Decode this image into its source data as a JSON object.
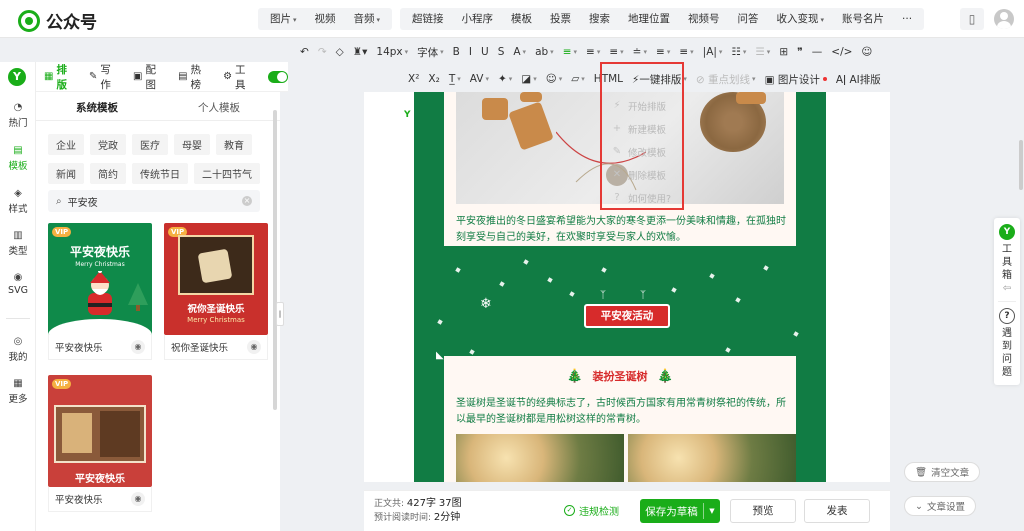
{
  "app": {
    "title": "公众号"
  },
  "topnav": {
    "media": [
      {
        "label": "图片",
        "caret": true
      },
      {
        "label": "视频",
        "caret": false
      },
      {
        "label": "音频",
        "caret": true
      }
    ],
    "insert": [
      {
        "label": "超链接",
        "caret": false
      },
      {
        "label": "小程序",
        "caret": false
      },
      {
        "label": "模板",
        "caret": false
      },
      {
        "label": "投票",
        "caret": false
      },
      {
        "label": "搜索",
        "caret": false
      },
      {
        "label": "地理位置",
        "caret": false
      },
      {
        "label": "视频号",
        "caret": false
      },
      {
        "label": "问答",
        "caret": false
      },
      {
        "label": "收入变现",
        "caret": true
      },
      {
        "label": "账号名片",
        "caret": false
      },
      {
        "label": "···",
        "caret": false
      }
    ]
  },
  "rail": {
    "brand": "Y",
    "items": [
      {
        "label": "热门",
        "icon": "◔"
      },
      {
        "label": "模板",
        "icon": "▤"
      },
      {
        "label": "样式",
        "icon": "◈"
      },
      {
        "label": "类型",
        "icon": "▥"
      },
      {
        "label": "SVG",
        "icon": "◉"
      },
      {
        "label": "我的",
        "icon": "◎"
      },
      {
        "label": "更多",
        "icon": "▦"
      }
    ]
  },
  "panel": {
    "tabs": [
      {
        "label": "排版",
        "icon": "▦"
      },
      {
        "label": "写作",
        "icon": "✎"
      },
      {
        "label": "配图",
        "icon": "▣"
      },
      {
        "label": "热榜",
        "icon": "▤"
      },
      {
        "label": "工具",
        "icon": "⚙"
      }
    ],
    "subtabs": [
      "系统模板",
      "个人模板"
    ],
    "categories": [
      "企业",
      "党政",
      "医疗",
      "母婴",
      "教育",
      "新闻",
      "简约",
      "传统节日",
      "二十四节气"
    ],
    "search": {
      "value": "平安夜",
      "icon": "⌕",
      "clear": "×"
    },
    "cards": [
      {
        "name": "平安夜快乐",
        "thumb_title": "平安夜快乐",
        "thumb_sub": "Merry Christmas",
        "vip": "VIP"
      },
      {
        "name": "祝你圣诞快乐",
        "thumb_title": "祝你圣诞快乐",
        "thumb_sub": "Merry Christmas",
        "vip": "VIP"
      },
      {
        "name": "平安夜快乐",
        "thumb_title": "平安夜快乐",
        "thumb_sub": "",
        "vip": "VIP"
      }
    ],
    "eye_icon": "◉",
    "handle_icon": "‖"
  },
  "toolbar1": [
    {
      "label": "↶",
      "name": "undo-icon"
    },
    {
      "label": "↷",
      "name": "redo-icon",
      "muted": true
    },
    {
      "label": "◇",
      "name": "eraser-icon"
    },
    {
      "label": "♜▾",
      "name": "format-painter-icon"
    },
    {
      "label": "14px",
      "name": "font-size-select",
      "caret": true
    },
    {
      "label": "字体",
      "name": "font-family-select",
      "caret": true
    },
    {
      "label": "B",
      "name": "bold-icon"
    },
    {
      "label": "I",
      "name": "italic-icon"
    },
    {
      "label": "U",
      "name": "underline-icon"
    },
    {
      "label": "S",
      "name": "strikethrough-icon"
    },
    {
      "label": "A",
      "name": "font-color-icon",
      "caret": true
    },
    {
      "label": "ab",
      "name": "highlight-icon",
      "caret": true
    },
    {
      "label": "≡",
      "name": "align-left-icon",
      "caret": true,
      "green": true
    },
    {
      "label": "≡",
      "name": "align-center-icon",
      "caret": true
    },
    {
      "label": "≡",
      "name": "indent-icon",
      "caret": true
    },
    {
      "label": "≐",
      "name": "line-height-icon",
      "caret": true
    },
    {
      "label": "≡",
      "name": "paragraph-spacing-icon",
      "caret": true
    },
    {
      "label": "≡",
      "name": "list-icon",
      "caret": true
    },
    {
      "label": "|A|",
      "name": "letter-spacing-icon",
      "caret": true
    },
    {
      "label": "☷",
      "name": "bullet-list-icon",
      "caret": true
    },
    {
      "label": "☰",
      "name": "number-list-icon",
      "caret": true,
      "muted": true
    },
    {
      "label": "⊞",
      "name": "table-icon"
    },
    {
      "label": "❞",
      "name": "quote-icon"
    },
    {
      "label": "—",
      "name": "divider-icon"
    },
    {
      "label": "</>",
      "name": "code-icon"
    },
    {
      "label": "☺",
      "name": "emoji-icon"
    }
  ],
  "toolbar2": [
    {
      "label": "X²",
      "name": "superscript-icon"
    },
    {
      "label": "X₂",
      "name": "subscript-icon"
    },
    {
      "label": "T̲",
      "name": "text-border-icon",
      "caret": true
    },
    {
      "label": "AV",
      "name": "kerning-icon",
      "caret": true
    },
    {
      "label": "✦",
      "name": "magic-icon",
      "caret": true
    },
    {
      "label": "◪",
      "name": "background-icon",
      "caret": true
    },
    {
      "label": "☺",
      "name": "emoji2-icon",
      "caret": true
    },
    {
      "label": "▱",
      "name": "image-icon",
      "caret": true
    },
    {
      "label": "HTML",
      "name": "html-icon"
    },
    {
      "label": "⚡一键排版",
      "name": "one-click-layout-button",
      "caret": true
    },
    {
      "label": "⊘ 重点划线",
      "name": "highlight-line-button",
      "caret": true,
      "muted": true
    },
    {
      "label": "▣ 图片设计",
      "name": "image-design-button",
      "dot": true
    },
    {
      "label": "Aǀ AI排版",
      "name": "ai-layout-button"
    }
  ],
  "dropdown": [
    {
      "label": "开始排版",
      "icon": "⚡"
    },
    {
      "label": "新建模板",
      "icon": "+"
    },
    {
      "label": "修改模板",
      "icon": "✎"
    },
    {
      "label": "删除模板",
      "icon": "✕"
    },
    {
      "label": "如何使用?",
      "icon": "?"
    }
  ],
  "article": {
    "para1": "平安夜推出的冬日盛宴希望能为大家的寒冬更添一份美味和情趣，在孤独时刻享受与自己的美好，在欢聚时享受与家人的欢愉。",
    "banner": "平安夜活动",
    "section_title": "装扮圣诞树",
    "tree_icon": "🎄",
    "para2": "圣诞树是圣诞节的经典标志了，古时候西方国家有用常青树祭祀的传统，所以最早的圣诞树都是用松树这样的常青树。"
  },
  "bottom": {
    "count_label": "正文共:",
    "chars": "427字",
    "images": "37图",
    "read_label": "预计阅读时间:",
    "read_time": "2分钟",
    "check": "违规检测",
    "save": "保存为草稿",
    "preview": "预览",
    "publish": "发表"
  },
  "side": {
    "toolbox": [
      "工",
      "具",
      "箱"
    ],
    "toolbox_arrow": "⇦",
    "help": [
      "遇",
      "到",
      "问",
      "题"
    ],
    "clear": "清空文章",
    "settings": "文章设置"
  },
  "colors": {
    "brand": "#1aad19",
    "article_bg": "#117c44",
    "accent_red": "#d72b2b",
    "highlight_box": "#e53935"
  }
}
